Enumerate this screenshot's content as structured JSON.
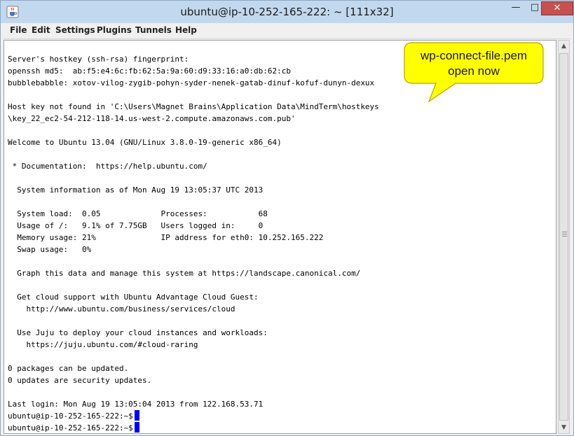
{
  "window": {
    "title": "ubuntu@ip-10-252-165-222: ~ [111x32]",
    "app_icon": "java-cup-icon",
    "buttons": {
      "minimize": "—",
      "maximize": "□",
      "close": "✕"
    }
  },
  "menu": [
    "File",
    "Edit",
    "Settings",
    "Plugins",
    "Tunnels",
    "Help"
  ],
  "terminal": {
    "lines": [
      "Server's hostkey (ssh-rsa) fingerprint:",
      "openssh md5:  ab:f5:e4:6c:fb:62:5a:9a:60:d9:33:16:a0:db:62:cb",
      "bubblebabble: xotov-vilog-zygib-pohyn-syder-nenek-gatab-dinuf-kofuf-dunyn-dexux",
      "",
      "Host key not found in 'C:\\Users\\Magnet Brains\\Application Data\\MindTerm\\hostkeys",
      "\\key_22_ec2-54-212-118-14.us-west-2.compute.amazonaws.com.pub'",
      "",
      "Welcome to Ubuntu 13.04 (GNU/Linux 3.8.0-19-generic x86_64)",
      "",
      " * Documentation:  https://help.ubuntu.com/",
      "",
      "  System information as of Mon Aug 19 13:05:37 UTC 2013",
      "",
      "  System load:  0.05             Processes:           68",
      "  Usage of /:   9.1% of 7.75GB   Users logged in:     0",
      "  Memory usage: 21%              IP address for eth0: 10.252.165.222",
      "  Swap usage:   0%",
      "",
      "  Graph this data and manage this system at https://landscape.canonical.com/",
      "",
      "  Get cloud support with Ubuntu Advantage Cloud Guest:",
      "    http://www.ubuntu.com/business/services/cloud",
      "",
      "  Use Juju to deploy your cloud instances and workloads:",
      "    https://juju.ubuntu.com/#cloud-raring",
      "",
      "0 packages can be updated.",
      "0 updates are security updates.",
      "",
      "Last login: Mon Aug 19 13:05:04 2013 from 122.168.53.71",
      "ubuntu@ip-10-252-165-222:~$",
      "ubuntu@ip-10-252-165-222:~$"
    ]
  },
  "scrollbar": {
    "up_arrow": "▲",
    "down_arrow": "▼"
  },
  "callout": {
    "text_line1": "wp-connect-file.pem",
    "text_line2": "open now",
    "fill": "#ffff00"
  }
}
